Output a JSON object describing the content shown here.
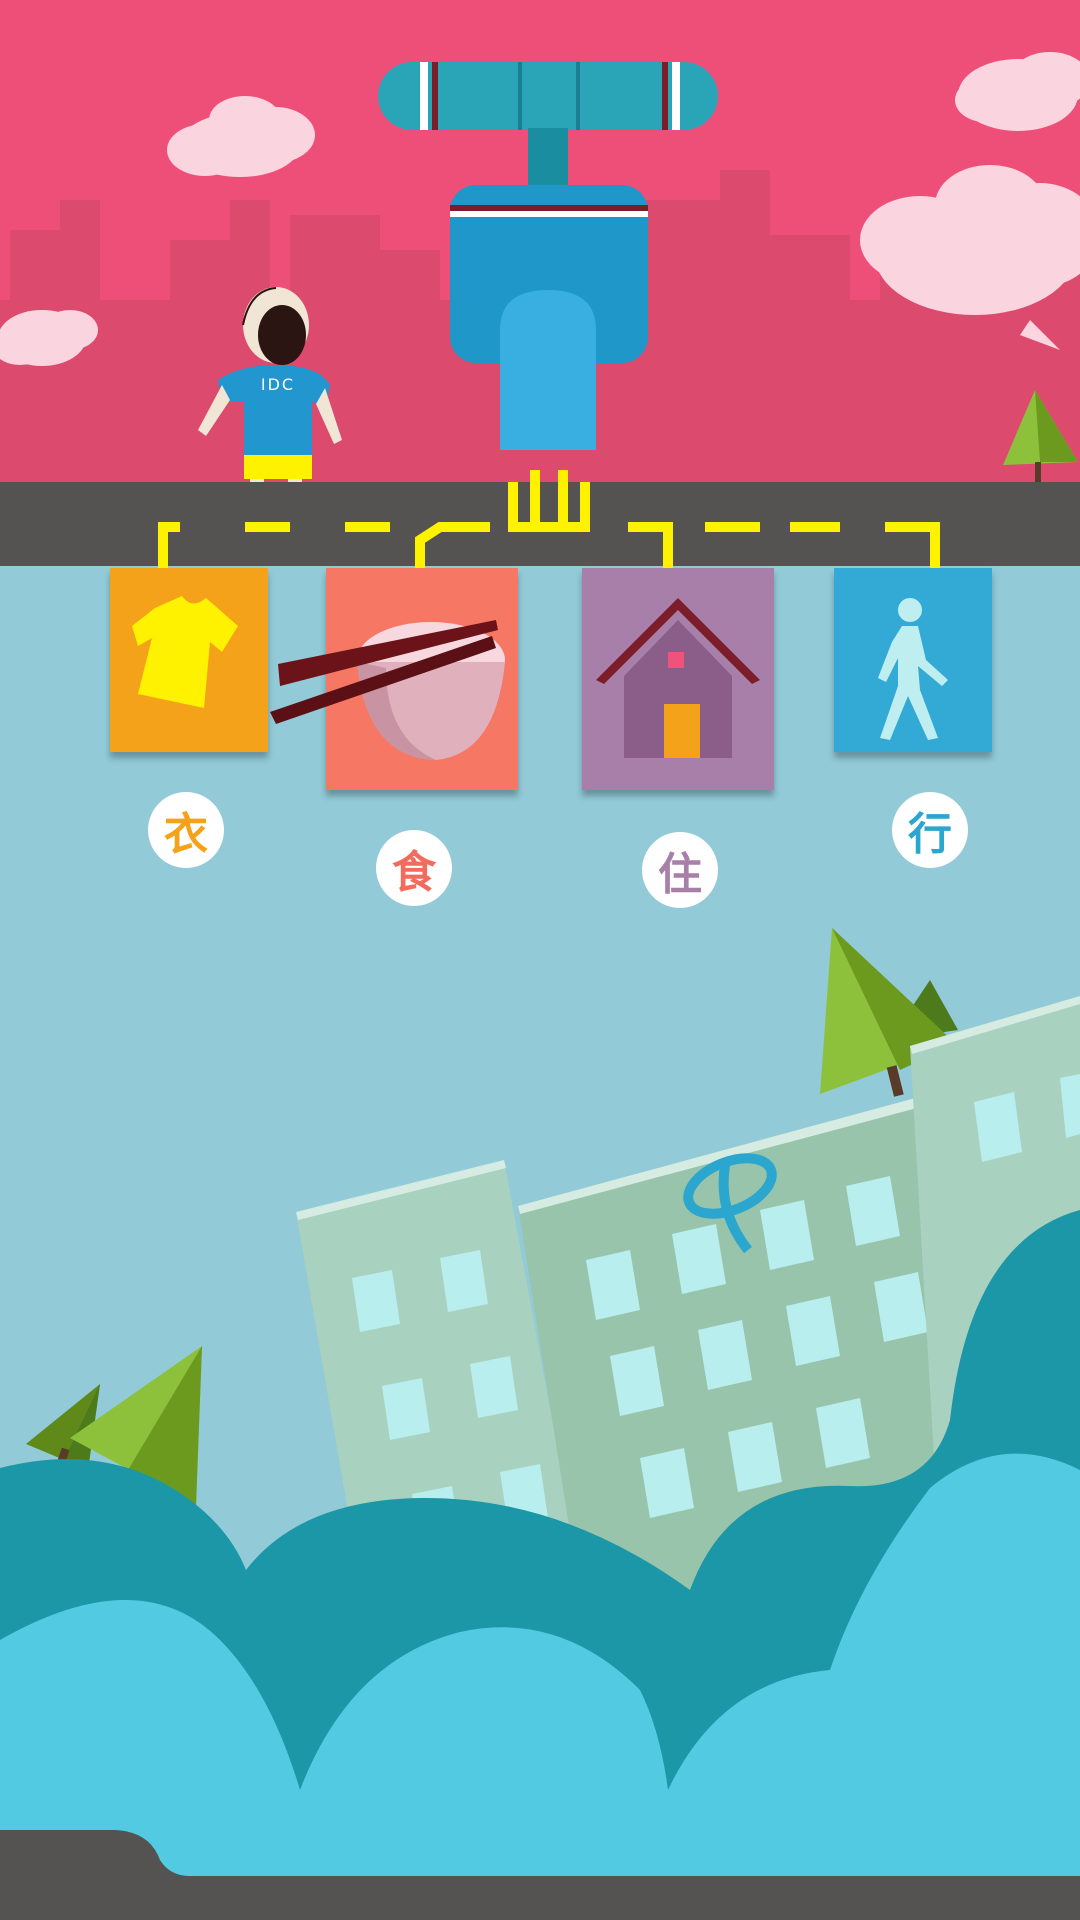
{
  "scene": {
    "boy_shirt_text": "IDC",
    "colors": {
      "sky": "#ee4f79",
      "skyline": "#dc4a6e",
      "road": "#545352",
      "road_dash": "#fff200",
      "lower_bg": "#92cad8",
      "faucet_blue": "#1f97c9",
      "faucet_light": "#39aee0",
      "hills_dark": "#1b97a8",
      "hills_light": "#52cbe2",
      "building": "#a9d1bf",
      "window": "#b8eeee",
      "tree_light": "#8dc13c",
      "tree_dark": "#6b9a1f"
    }
  },
  "categories": [
    {
      "label": "衣",
      "icon": "shirt-icon",
      "color": "#f5a21b"
    },
    {
      "label": "食",
      "icon": "rice-bowl-icon",
      "color": "#f57764"
    },
    {
      "label": "住",
      "icon": "house-icon",
      "color": "#a77fa8"
    },
    {
      "label": "行",
      "icon": "walking-person-icon",
      "color": "#33aad5"
    }
  ]
}
